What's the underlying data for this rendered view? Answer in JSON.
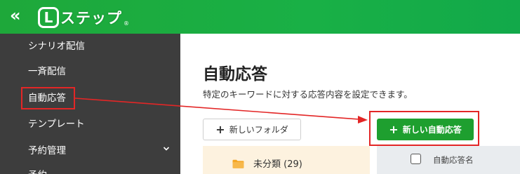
{
  "header": {
    "collapse_glyph": "«",
    "logo": {
      "mark": "L",
      "text": "ステップ",
      "reg": "®"
    },
    "colors": {
      "brand_green": "#1ea83a"
    }
  },
  "sidebar": {
    "items": [
      {
        "label": "シナリオ配信"
      },
      {
        "label": "一斉配信"
      },
      {
        "label": "自動応答"
      },
      {
        "label": "テンプレート"
      },
      {
        "label": "予約管理"
      },
      {
        "label": "予約"
      }
    ]
  },
  "main": {
    "title": "自動応答",
    "description": "特定のキーワードに対する応答内容を設定できます。",
    "new_folder_button": "新しいフォルダ",
    "new_response_button": "新しい自動応答",
    "plus_glyph": "+",
    "folder": {
      "label": "未分類 (29)"
    },
    "table": {
      "column_name": "自動応答名"
    }
  },
  "annotation": {
    "highlight_color": "#e32626"
  }
}
